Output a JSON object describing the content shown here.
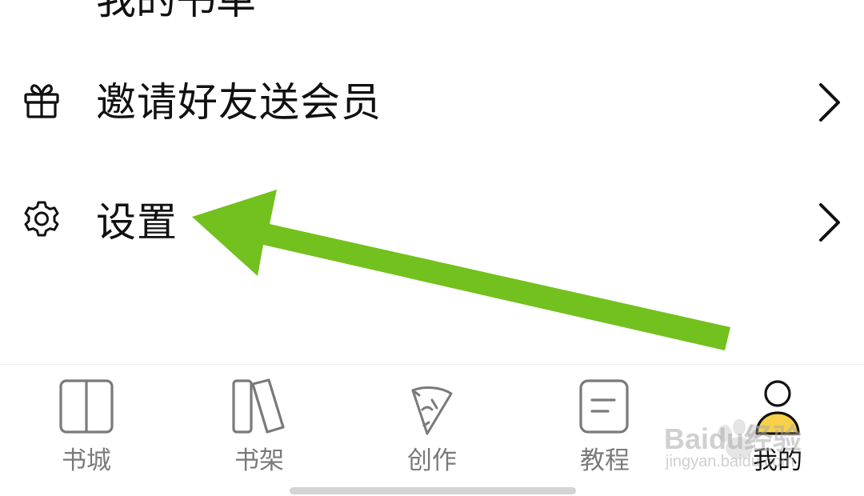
{
  "top_partial": {
    "text": "我的书单"
  },
  "menu": {
    "items": [
      {
        "label": "邀请好友送会员",
        "icon": "gift-icon"
      },
      {
        "label": "设置",
        "icon": "gear-icon"
      }
    ]
  },
  "annotation": {
    "arrow_color": "#72c11e",
    "icon": "arrow-pointer"
  },
  "tabbar": {
    "active_index": 4,
    "tabs": [
      {
        "label": "书城",
        "icon": "book-open-icon"
      },
      {
        "label": "书架",
        "icon": "bookshelf-icon"
      },
      {
        "label": "创作",
        "icon": "pen-cone-icon"
      },
      {
        "label": "教程",
        "icon": "document-icon"
      },
      {
        "label": "我的",
        "icon": "profile-icon"
      }
    ],
    "active_color": "#111111",
    "inactive_color": "#7a7a7a",
    "accent_color": "#f7d14a"
  },
  "watermark": {
    "brand": "Baidu经验",
    "url": "jingyan.baidu.com"
  }
}
